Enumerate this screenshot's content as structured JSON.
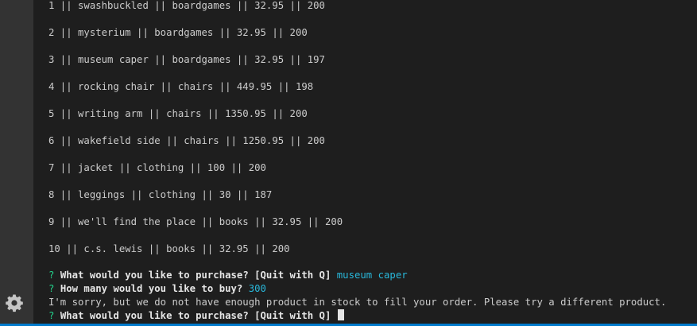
{
  "colors": {
    "background": "#1e1e1e",
    "activity_bar": "#333333",
    "status_strip": "#007acc",
    "text": "#cccccc",
    "prompt_mark": "#23d18b",
    "answer": "#29b8db"
  },
  "activity_bar": {
    "gear_icon": "gear-icon"
  },
  "terminal": {
    "rows": [
      "1 || swashbuckled || boardgames || 32.95 || 200",
      "2 || mysterium || boardgames || 32.95 || 200",
      "3 || museum caper || boardgames || 32.95 || 197",
      "4 || rocking chair || chairs || 449.95 || 198",
      "5 || writing arm || chairs || 1350.95 || 200",
      "6 || wakefield side || chairs || 1250.95 || 200",
      "7 || jacket || clothing || 100 || 200",
      "8 || leggings || clothing || 30 || 187",
      "9 || we'll find the place || books || 32.95 || 200",
      "10 || c.s. lewis || books || 32.95 || 200"
    ],
    "prompt_mark": "?",
    "prompt1_question": "What would you like to purchase? [Quit with Q]",
    "prompt1_answer": "museum caper",
    "prompt2_question": "How many would you like to buy?",
    "prompt2_answer": "300",
    "error_message": "I'm sorry, but we do not have enough product in stock to fill your order. Please try a different product.",
    "prompt3_question": "What would you like to purchase? [Quit with Q]"
  }
}
